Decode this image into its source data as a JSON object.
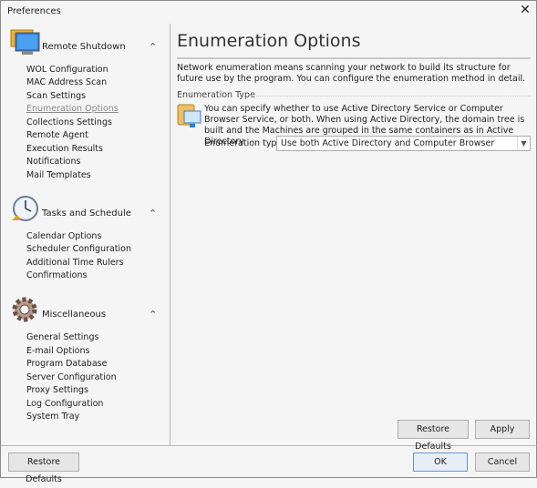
{
  "window": {
    "title": "Preferences",
    "close_icon": "close-icon"
  },
  "sidebar": {
    "sections": [
      {
        "title": "Remote Shutdown",
        "icon": "monitor-icon",
        "items": [
          "WOL Configuration",
          "MAC Address Scan",
          "Scan Settings",
          "Enumeration Options",
          "Collections Settings",
          "Remote Agent",
          "Execution Results",
          "Notifications",
          "Mail Templates"
        ],
        "active": "Enumeration Options"
      },
      {
        "title": "Tasks and Schedule",
        "icon": "clock-icon",
        "items": [
          "Calendar Options",
          "Scheduler Configuration",
          "Additional Time Rulers",
          "Confirmations"
        ]
      },
      {
        "title": "Miscellaneous",
        "icon": "gear-icon",
        "items": [
          "General Settings",
          "E-mail Options",
          "Program Database",
          "Server Configuration",
          "Proxy Settings",
          "Log Configuration",
          "System Tray"
        ]
      }
    ]
  },
  "main": {
    "title": "Enumeration Options",
    "description": "Network enumeration means scanning your network to build its structure for future use by the program. You can configure the enumeration method in detail.",
    "group_title": "Enumeration Type",
    "group_description": "You can specify whether to use Active Directory Service or Computer Browser Service, or both. When using Active Directory, the domain tree is built and the Machines are grouped in the same containers as in Active Directory.",
    "enum_label": "Enumeration type:",
    "enum_value": "Use both Active Directory and Computer Browser",
    "restore_defaults": "Restore Defaults",
    "apply": "Apply"
  },
  "footer": {
    "restore_defaults": "Restore Defaults",
    "ok": "OK",
    "cancel": "Cancel"
  }
}
